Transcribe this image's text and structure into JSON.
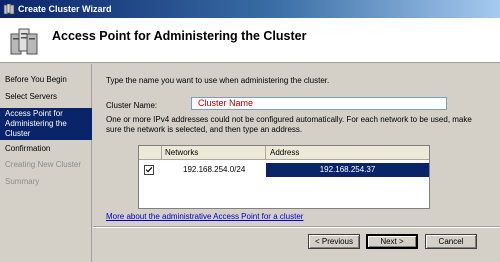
{
  "window": {
    "title": "Create Cluster Wizard"
  },
  "header": {
    "page_title": "Access Point for Administering the Cluster"
  },
  "sidebar": {
    "items": [
      {
        "label": "Before You Begin",
        "state": "normal"
      },
      {
        "label": "Select Servers",
        "state": "normal"
      },
      {
        "label": "Access Point for Administering the Cluster",
        "state": "active"
      },
      {
        "label": "Confirmation",
        "state": "normal"
      },
      {
        "label": "Creating New Cluster",
        "state": "disabled"
      },
      {
        "label": "Summary",
        "state": "disabled"
      }
    ]
  },
  "content": {
    "instruction": "Type the name you want to use when administering the cluster.",
    "cluster_name_label": "Cluster Name:",
    "cluster_name_value": "Cluster Name",
    "ipv4_note_line1": "One or more IPv4 addresses could not be configured automatically.  For each network to be used, make",
    "ipv4_note_line2": "sure the network is selected, and then type an address.",
    "grid": {
      "columns": [
        "Networks",
        "Address"
      ],
      "rows": [
        {
          "checked": true,
          "network": "192.168.254.0/24",
          "address": "192.168.254.37"
        }
      ]
    },
    "more_link": "More about the administrative Access Point for a cluster"
  },
  "buttons": {
    "previous": "< Previous",
    "next": "Next >",
    "cancel": "Cancel"
  },
  "colors": {
    "selection": "#0a246a",
    "link": "#0000cc",
    "name_text": "#c00000"
  }
}
